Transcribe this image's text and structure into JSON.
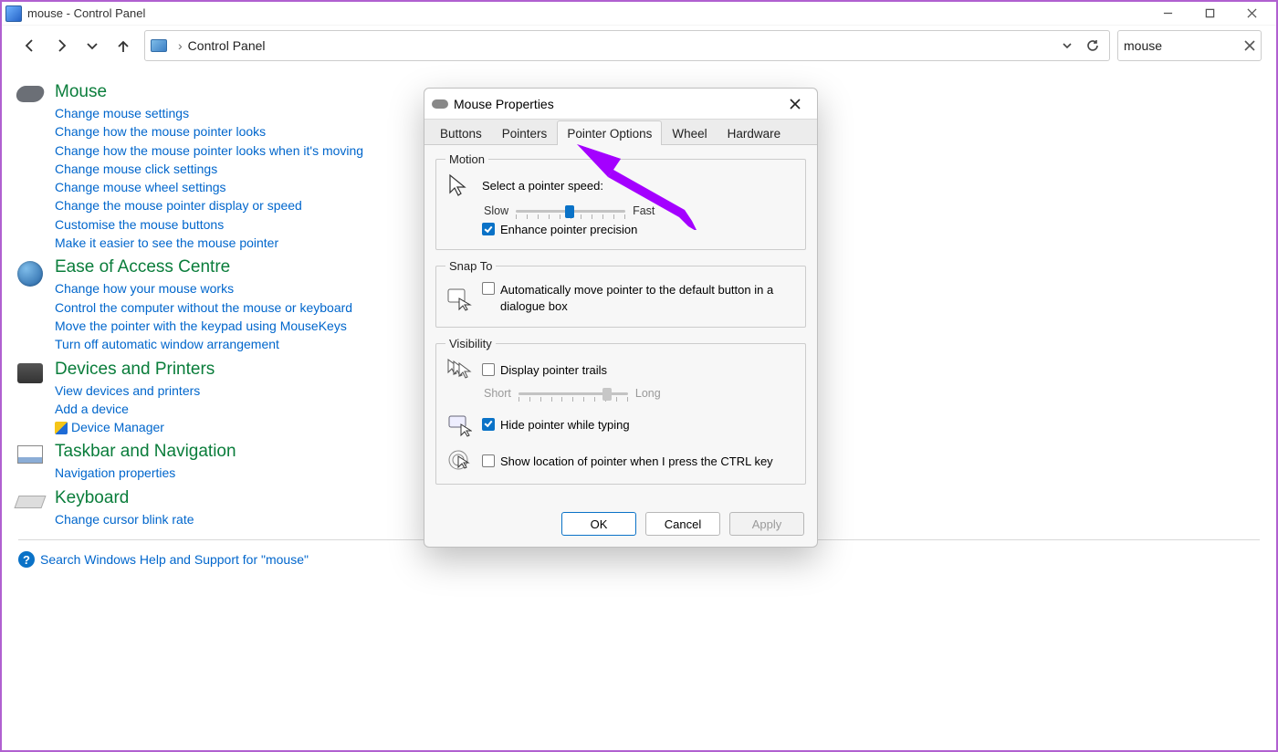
{
  "window": {
    "title": "mouse - Control Panel"
  },
  "nav": {
    "breadcrumb": "Control Panel",
    "search_value": "mouse"
  },
  "groups": [
    {
      "title": "Mouse",
      "links": [
        "Change mouse settings",
        "Change how the mouse pointer looks",
        "Change how the mouse pointer looks when it's moving",
        "Change mouse click settings",
        "Change mouse wheel settings",
        "Change the mouse pointer display or speed",
        "Customise the mouse buttons",
        "Make it easier to see the mouse pointer"
      ]
    },
    {
      "title": "Ease of Access Centre",
      "links": [
        "Change how your mouse works",
        "Control the computer without the mouse or keyboard",
        "Move the pointer with the keypad using MouseKeys",
        "Turn off automatic window arrangement"
      ]
    },
    {
      "title": "Devices and Printers",
      "links": [
        "View devices and printers",
        "Add a device",
        "Device Manager"
      ],
      "shield_on": 2
    },
    {
      "title": "Taskbar and Navigation",
      "links": [
        "Navigation properties"
      ]
    },
    {
      "title": "Keyboard",
      "links": [
        "Change cursor blink rate"
      ]
    }
  ],
  "help_line": "Search Windows Help and Support for \"mouse\"",
  "dialog": {
    "title": "Mouse Properties",
    "tabs": [
      "Buttons",
      "Pointers",
      "Pointer Options",
      "Wheel",
      "Hardware"
    ],
    "active_tab_index": 2,
    "motion": {
      "legend": "Motion",
      "label": "Select a pointer speed:",
      "slow": "Slow",
      "fast": "Fast",
      "enhance": {
        "label": "Enhance pointer precision",
        "checked": true
      }
    },
    "snap": {
      "legend": "Snap To",
      "auto": {
        "label": "Automatically move pointer to the default button in a dialogue box",
        "checked": false
      }
    },
    "visibility": {
      "legend": "Visibility",
      "trails": {
        "label": "Display pointer trails",
        "checked": false,
        "short": "Short",
        "long": "Long"
      },
      "hide_typing": {
        "label": "Hide pointer while typing",
        "checked": true
      },
      "ctrl_locate": {
        "label": "Show location of pointer when I press the CTRL key",
        "checked": false
      }
    },
    "buttons": {
      "ok": "OK",
      "cancel": "Cancel",
      "apply": "Apply"
    }
  }
}
